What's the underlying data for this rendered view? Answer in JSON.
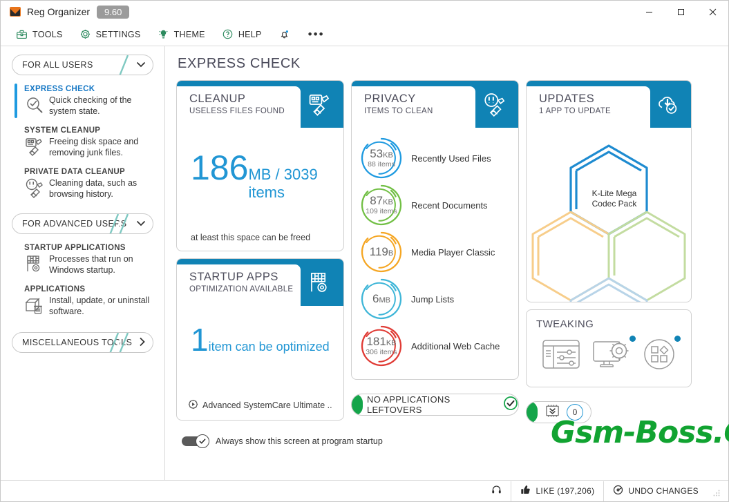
{
  "window": {
    "app_title": "Reg Organizer",
    "version": "9.60",
    "logo_icon": "reg-organizer-logo",
    "controls": {
      "minimize": "–",
      "maximize": "□",
      "close": "✕"
    }
  },
  "menubar": {
    "items": [
      {
        "label": "TOOLS",
        "icon": "toolbox-icon"
      },
      {
        "label": "SETTINGS",
        "icon": "gear-icon"
      },
      {
        "label": "THEME",
        "icon": "lightbulb-icon"
      },
      {
        "label": "HELP",
        "icon": "question-circle-icon"
      }
    ],
    "notification_icon": "bell-icon",
    "overflow": "•••"
  },
  "sidebar": {
    "groups": [
      {
        "label": "FOR ALL USERS",
        "chevron": "⌄",
        "items": [
          {
            "title": "EXPRESS CHECK",
            "desc": "Quick checking of the system state.",
            "icon": "magnifier-check-icon",
            "active": true
          },
          {
            "title": "SYSTEM CLEANUP",
            "desc": "Freeing disk space and removing junk files.",
            "icon": "disk-broom-icon",
            "active": false
          },
          {
            "title": "PRIVATE DATA CLEANUP",
            "desc": "Cleaning data, such as browsing history.",
            "icon": "privacy-broom-icon",
            "active": false
          }
        ]
      },
      {
        "label": "FOR ADVANCED USERS",
        "chevron": "⌄",
        "items": [
          {
            "title": "STARTUP APPLICATIONS",
            "desc": "Processes that run on Windows startup.",
            "icon": "flag-gear-icon",
            "active": false
          },
          {
            "title": "APPLICATIONS",
            "desc": "Install, update, or uninstall software.",
            "icon": "box-trash-icon",
            "active": false
          }
        ]
      }
    ],
    "misc": {
      "label": "MISCELLANEOUS TOOLS",
      "chevron": "›"
    }
  },
  "main": {
    "page_title": "EXPRESS CHECK",
    "cleanup": {
      "title": "CLEANUP",
      "subtitle": "USELESS FILES FOUND",
      "icon": "disk-broom-icon",
      "value": "186",
      "unit": "MB / 3039 items",
      "footer": "at least this space can be freed"
    },
    "startup_apps": {
      "title": "STARTUP APPS",
      "subtitle": "OPTIMIZATION AVAILABLE",
      "icon": "flag-gear-icon",
      "value": "1",
      "value_text": "item can be optimized",
      "footer": "Advanced SystemCare Ultimate ...",
      "footer_icon": "play-circle-icon"
    },
    "privacy": {
      "title": "PRIVACY",
      "subtitle": "ITEMS TO CLEAN",
      "icon": "privacy-broom-icon",
      "rows": [
        {
          "value": "53",
          "unit": "KB",
          "items": "88 items",
          "label": "Recently Used Files",
          "color": "#1e9ae0"
        },
        {
          "value": "87",
          "unit": "KB",
          "items": "109 items",
          "label": "Recent Documents",
          "color": "#71bf44"
        },
        {
          "value": "119",
          "unit": "B",
          "items": "",
          "label": "Media Player Classic",
          "color": "#f5a623"
        },
        {
          "value": "6",
          "unit": "MB",
          "items": "",
          "label": "Jump Lists",
          "color": "#3fb6d8"
        },
        {
          "value": "181",
          "unit": "KB",
          "items": "306 items",
          "label": "Additional Web Cache",
          "color": "#e03b35"
        }
      ]
    },
    "updates": {
      "title": "UPDATES",
      "subtitle": "1 APP TO UPDATE",
      "icon": "cloud-download-check-icon",
      "app_name": "K-Lite Mega Codec Pack",
      "hex_colors": [
        "#1e8bd0",
        "#f7cd8a",
        "#c3dca0",
        "#b8d4e8"
      ]
    },
    "tweaking": {
      "title": "TWEAKING",
      "icons": [
        "sliders-panel-icon",
        "monitor-gear-icon",
        "shapes-circle-icon"
      ],
      "badge_color": "#1083b5"
    },
    "leftovers_pill": {
      "text": "NO APPLICATIONS LEFTOVERS",
      "status_icon": "check-circle-icon"
    },
    "memory_pill": {
      "icon": "chip-icon",
      "count": "0"
    },
    "startup_toggle": {
      "label": "Always show this screen at program startup",
      "checked": true
    }
  },
  "watermark": {
    "text": "Gsm-Boss.Com",
    "color": "#11a331"
  },
  "statusbar": {
    "items": [
      {
        "label": "",
        "icon": "headset-icon"
      },
      {
        "label": "LIKE (197,206)",
        "icon": "thumbs-up-icon"
      },
      {
        "label": "UNDO CHANGES",
        "icon": "undo-circle-icon"
      }
    ]
  }
}
